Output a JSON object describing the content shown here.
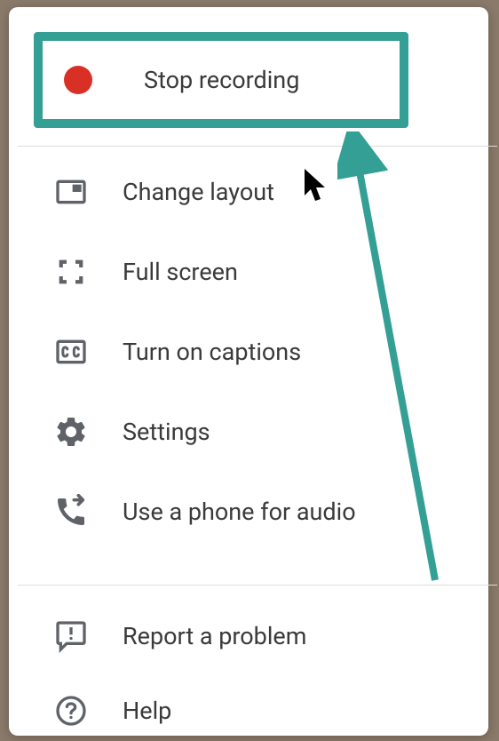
{
  "menu": {
    "stop_recording_label": "Stop recording",
    "change_layout_label": "Change layout",
    "full_screen_label": "Full screen",
    "captions_label": "Turn on captions",
    "settings_label": "Settings",
    "phone_audio_label": "Use a phone for audio",
    "report_problem_label": "Report a problem",
    "help_label": "Help"
  },
  "colors": {
    "highlight_border": "#349f94",
    "record_dot": "#d93025",
    "icon_gray": "#5f6368"
  }
}
